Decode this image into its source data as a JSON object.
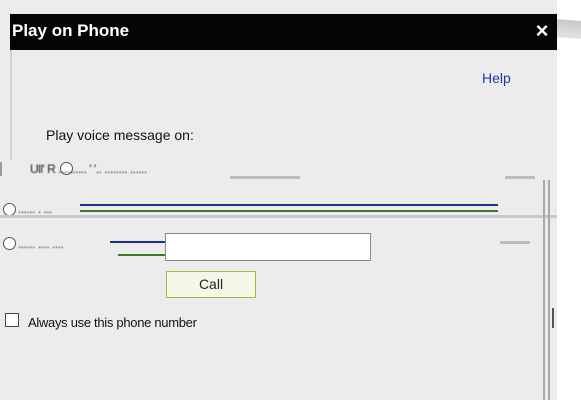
{
  "dialog": {
    "title": "Play on Phone",
    "close_glyph": "×",
    "help_label": "Help",
    "prompt": "Play voice message on:",
    "options": [
      {
        "label_garbled": "Ull'  R .......... ' '.. ........ ......"
      },
      {
        "label_garbled": "...... . ..."
      },
      {
        "label_garbled": "...... .... ...."
      }
    ],
    "phone_input": {
      "value": "",
      "placeholder": ""
    },
    "call_label": "Call",
    "checkbox_label": "Always use this phone number",
    "checkbox_checked": false
  },
  "colors": {
    "titlebar": "#050505",
    "dialog_bg": "#ececec",
    "help_link": "#1a3aa6",
    "call_border": "#9bbf3c",
    "divider_blue": "#1f2f8a",
    "divider_green": "#3a7a2a"
  }
}
